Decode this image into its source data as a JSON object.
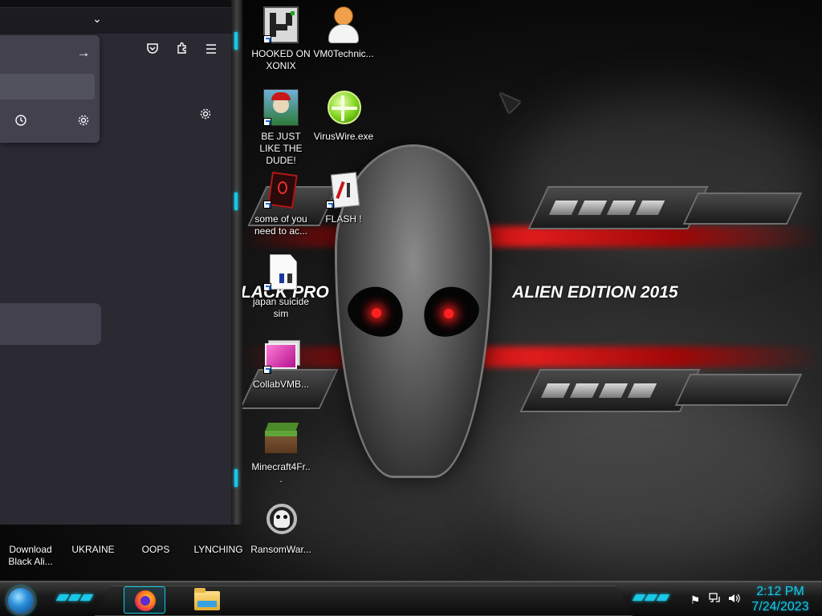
{
  "wallpaper": {
    "title": "ALIEN EDITION 2015",
    "left_fragment": "LACK PRO",
    "accent_color": "#ff1a1a"
  },
  "desktop_icons": [
    {
      "label": "HOOKED ON XONIX",
      "icon": "xonix-game-icon",
      "shortcut": true
    },
    {
      "label": "VM0Technic...",
      "icon": "technician-person-icon",
      "shortcut": false
    },
    {
      "label": "BE JUST LIKE THE DUDE!",
      "icon": "dude-character-icon",
      "shortcut": true
    },
    {
      "label": "VirusWire.exe",
      "icon": "lime-orb-icon",
      "shortcut": false
    },
    {
      "label": "some of you need to ac...",
      "icon": "red-document-icon",
      "shortcut": true
    },
    {
      "label": "FLASH !",
      "icon": "flash-document-icon",
      "shortcut": true
    },
    {
      "label": "japan suicide sim",
      "icon": "suicide-sim-icon",
      "shortcut": true
    },
    {
      "label": "CollabVMB...",
      "icon": "pink-screen-icon",
      "shortcut": true
    },
    {
      "label": "Minecraft4Fr...",
      "icon": "grass-block-icon",
      "shortcut": false
    },
    {
      "label": "RansomWar...",
      "icon": "skull-icon",
      "shortcut": false
    },
    {
      "label": "Download Black Ali...",
      "icon": "alien-shortcut-icon",
      "shortcut": true
    },
    {
      "label": "UKRAINE",
      "icon": "alien-shortcut-icon",
      "shortcut": true
    },
    {
      "label": "OOPS",
      "icon": "alien-shortcut-icon",
      "shortcut": true
    },
    {
      "label": "LYNCHING",
      "icon": "alien-shortcut-icon",
      "shortcut": true
    }
  ],
  "firefox": {
    "icons": {
      "tab_list": "chevron-down-icon",
      "go": "arrow-right-icon",
      "pocket": "pocket-icon",
      "extensions": "puzzle-icon",
      "menu": "hamburger-menu-icon",
      "history": "clock-icon",
      "settings": "gear-icon"
    },
    "colors": {
      "background": "#2b2a33",
      "popup": "#42414d"
    }
  },
  "taskbar": {
    "apps": [
      {
        "name": "Firefox",
        "icon": "firefox-icon",
        "active": true
      },
      {
        "name": "File Explorer",
        "icon": "folder-icon",
        "active": false
      }
    ],
    "tray_icons": [
      "flag-icon",
      "network-icon",
      "speaker-icon"
    ],
    "clock": {
      "time": "2:12 PM",
      "date": "7/24/2023"
    },
    "accent_color": "#19c7e6"
  }
}
